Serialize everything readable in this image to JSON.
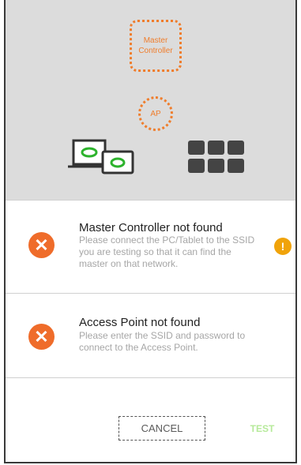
{
  "diagram": {
    "master_controller_label": "Master Controller",
    "access_point_label": "AP"
  },
  "errors": [
    {
      "title": "Master Controller not found",
      "description": "Please connect the PC/Tablet to the SSID you are testing so that it can find the master on that network.",
      "status": "error",
      "warning": true
    },
    {
      "title": "Access Point not found",
      "description": "Please enter the SSID and password to connect to the Access Point.",
      "status": "error",
      "warning": false
    }
  ],
  "actions": {
    "cancel_label": "CANCEL",
    "test_label": "TEST"
  },
  "colors": {
    "accent_orange": "#ef7d2c",
    "error": "#ef6c2a",
    "warning": "#f0a30a",
    "test_disabled": "#b6ea9a",
    "diagram_bg": "#dcdcdc"
  },
  "icons": [
    "error-x-icon",
    "warning-exclamation-icon",
    "laptop-tablet-icon",
    "device-grid-icon"
  ]
}
